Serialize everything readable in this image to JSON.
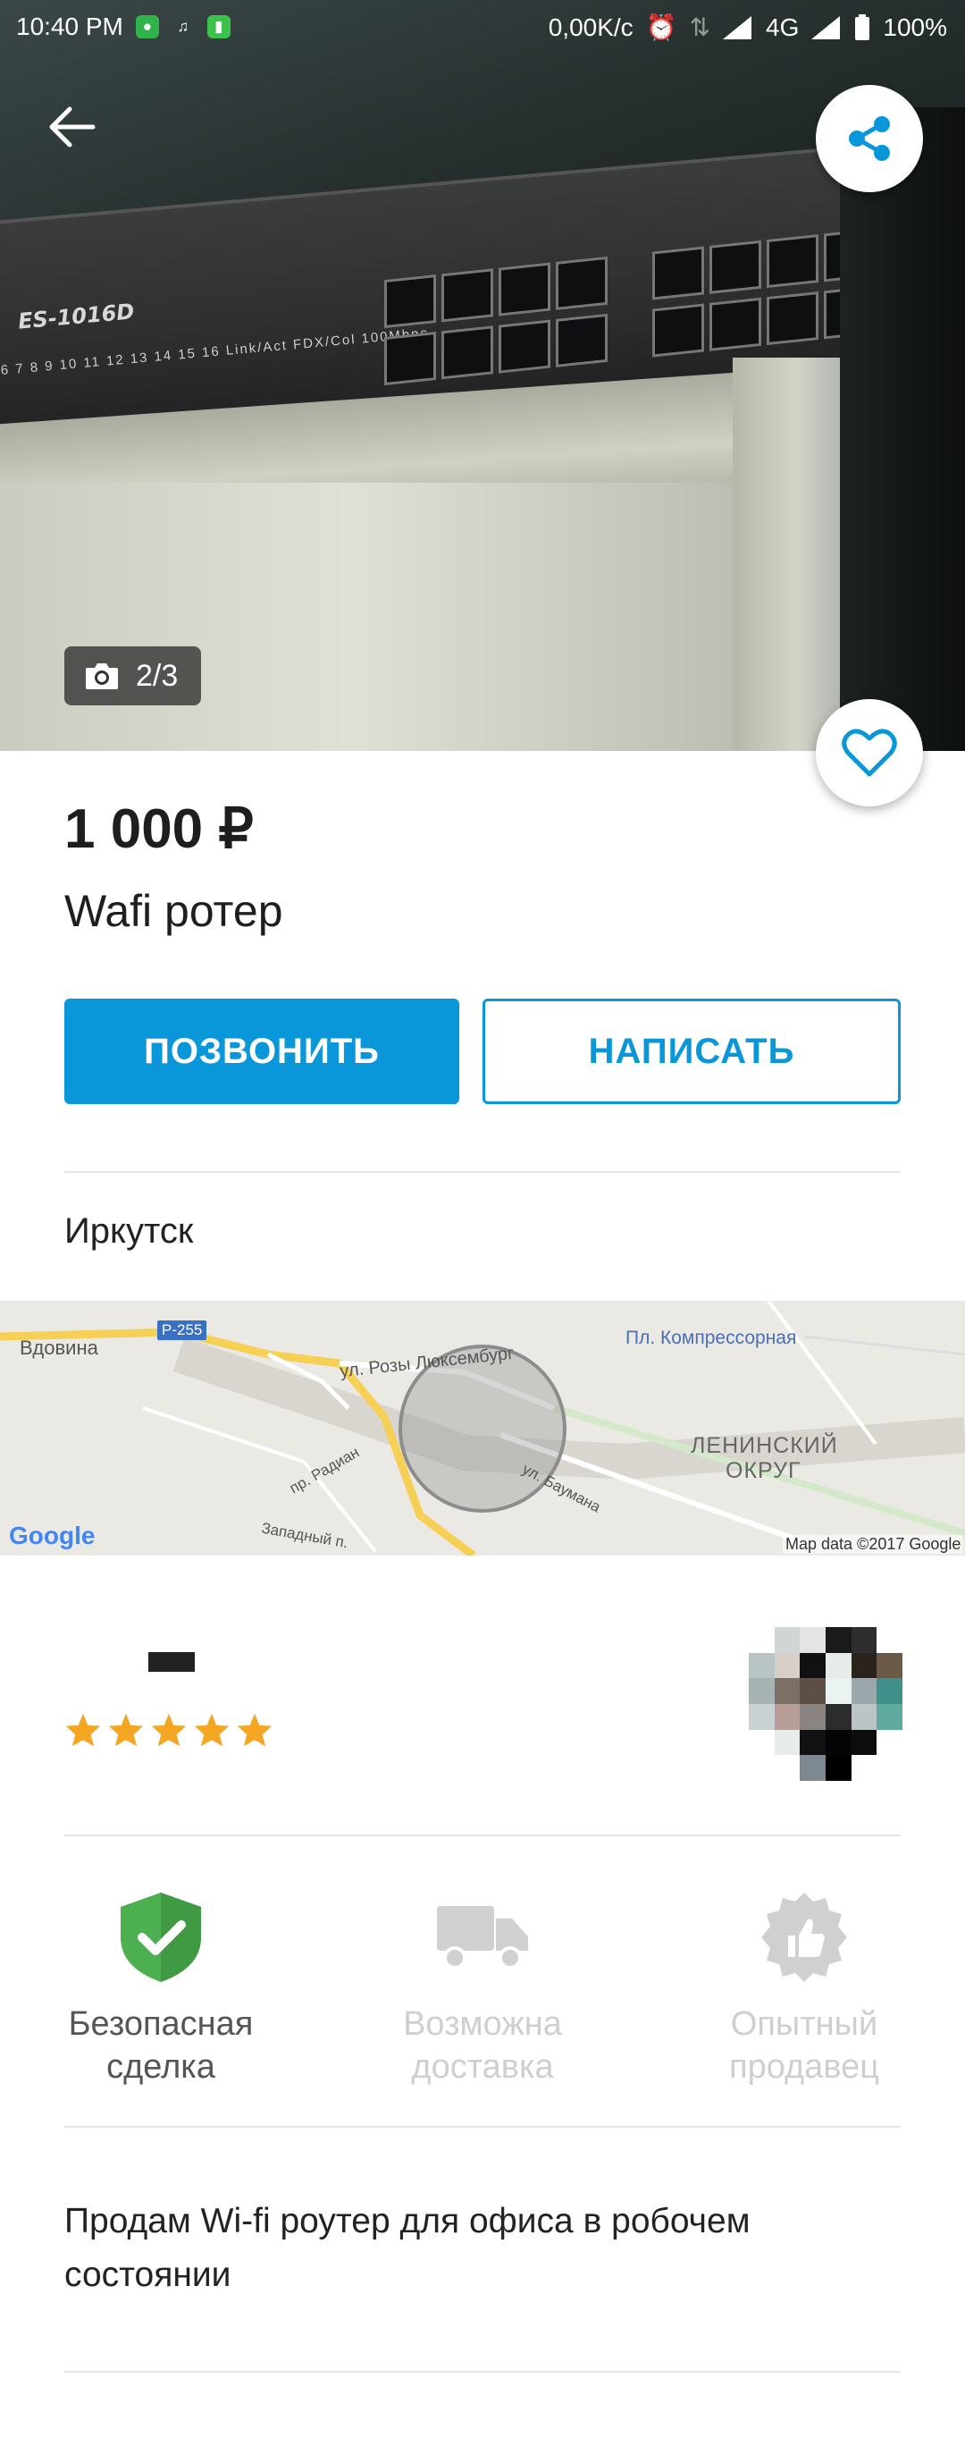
{
  "statusbar": {
    "time": "10:40 PM",
    "network_speed": "0,00K/c",
    "network_type": "4G",
    "battery": "100%"
  },
  "photo": {
    "counter": "2/3",
    "switch_model": "ES-1016D",
    "switch_leds": "6  7  8  9  10  11  12  13  14  15  16   Link/Act  FDX/Col  100Mbps"
  },
  "listing": {
    "price": "1 000 ₽",
    "title": "Wafi ротер",
    "call_label": "ПОЗВОНИТЬ",
    "write_label": "НАПИСАТЬ",
    "city": "Иркутск",
    "description": "Продам Wi-fi роутер для офиса в робочем состоянии"
  },
  "map": {
    "labels": {
      "vdovina": "Вдовина",
      "road": "Р-255",
      "rosa": "ул. Розы Люксембург",
      "kompressornaya": "Пл. Компрессорная",
      "district_line1": "ЛЕНИНСКИЙ",
      "district_line2": "ОКРУГ",
      "radian": "пр. Радиан",
      "baumana": "ул. Баумана",
      "zapadny": "Западный п.",
      "google": "Google",
      "attribution": "Map data ©2017 Google"
    }
  },
  "seller": {
    "rating_stars": 5
  },
  "features": [
    {
      "line1": "Безопасная",
      "line2": "сделка",
      "active": true
    },
    {
      "line1": "Возможна",
      "line2": "доставка",
      "active": false
    },
    {
      "line1": "Опытный",
      "line2": "продавец",
      "active": false
    }
  ],
  "colors": {
    "accent": "#0a97d9",
    "star": "#f5a623",
    "shield": "#4caf50",
    "inactive": "#d0d0d0"
  }
}
